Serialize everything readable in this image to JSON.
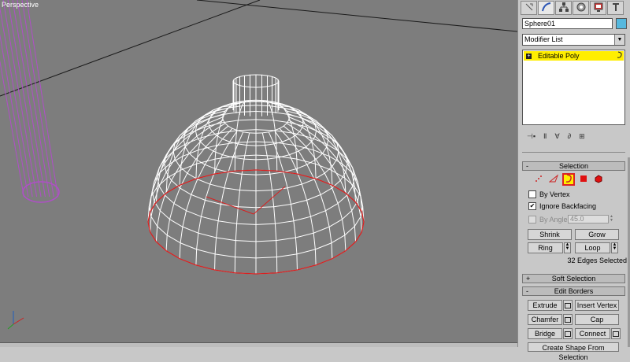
{
  "viewport": {
    "label": "Perspective",
    "colors": {
      "background": "#7d7d7d",
      "wire_object": "#ffffff",
      "selected_edges": "#d82020",
      "cylinder": "#b04ec8"
    }
  },
  "panel": {
    "tabs": [
      "create-icon",
      "modify-icon",
      "hierarchy-icon",
      "motion-icon",
      "display-icon",
      "utilities-icon"
    ],
    "object_name": "Sphere01",
    "object_color": "#55b8de",
    "modifier_list": "Modifier List",
    "stack": [
      {
        "label": "Editable Poly",
        "highlight": "#ffee00"
      }
    ],
    "selection": {
      "title": "Selection",
      "sign": "-",
      "by_vertex": "By Vertex",
      "ignore_backfacing": "Ignore Backfacing",
      "ignore_backfacing_checked": "✔",
      "by_angle": "By Angle:",
      "angle_value": "45.0",
      "shrink": "Shrink",
      "grow": "Grow",
      "ring": "Ring",
      "loop": "Loop",
      "status": "32 Edges Selected"
    },
    "soft_selection": {
      "title": "Soft Selection",
      "sign": "+"
    },
    "edit_borders": {
      "title": "Edit Borders",
      "sign": "-",
      "extrude": "Extrude",
      "insert_vertex": "Insert Vertex",
      "chamfer": "Chamfer",
      "cap": "Cap",
      "bridge": "Bridge",
      "connect": "Connect",
      "create_shape": "Create Shape From Selection"
    }
  }
}
